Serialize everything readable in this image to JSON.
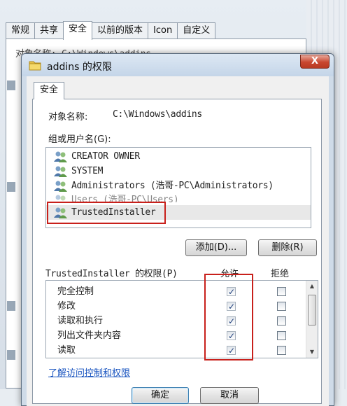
{
  "background": {
    "tabs": [
      "常规",
      "共享",
      "安全",
      "以前的版本",
      "Icon",
      "自定义"
    ],
    "active_tab_index": 2,
    "partial_text": "对象名称:    C:\\Windows\\addins"
  },
  "dialog": {
    "title": "addins 的权限",
    "close_label": "X",
    "tab_label": "安全",
    "object_label": "对象名称:",
    "object_path": "C:\\Windows\\addins",
    "group_label": "组或用户名(G):",
    "users": [
      {
        "name": "CREATOR OWNER",
        "icon": "users-icon"
      },
      {
        "name": "SYSTEM",
        "icon": "users-icon"
      },
      {
        "name": "Administrators (浩哥-PC\\Administrators)",
        "icon": "users-icon"
      },
      {
        "name": "Users (浩哥-PC\\Users)",
        "icon": "users-icon"
      },
      {
        "name": "TrustedInstaller",
        "icon": "users-icon"
      }
    ],
    "selected_user_index": 4,
    "add_button": "添加(D)...",
    "remove_button": "删除(R)",
    "permissions_label": "TrustedInstaller 的权限(P)",
    "allow_header": "允许",
    "deny_header": "拒绝",
    "permissions": [
      {
        "name": "完全控制",
        "allow": true,
        "deny": false
      },
      {
        "name": "修改",
        "allow": true,
        "deny": false
      },
      {
        "name": "读取和执行",
        "allow": true,
        "deny": false
      },
      {
        "name": "列出文件夹内容",
        "allow": true,
        "deny": false
      },
      {
        "name": "读取",
        "allow": true,
        "deny": false
      }
    ],
    "help_link": "了解访问控制和权限",
    "ok_button": "确定",
    "cancel_button": "取消"
  },
  "colors": {
    "highlight_box": "#c8201b",
    "link": "#1a55c0",
    "close_button": "#c8462f"
  }
}
